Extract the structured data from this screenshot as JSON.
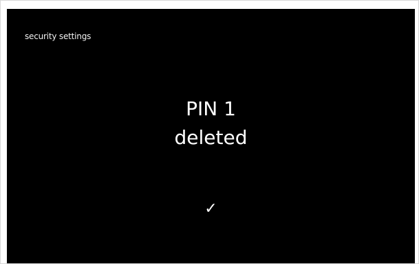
{
  "screen": {
    "title": "security settings",
    "message_line1": "PIN 1",
    "message_line2": "deleted",
    "confirm_symbol": "✓",
    "confirm_icon": "checkmark-icon",
    "background_color": "#000000",
    "text_color": "#ffffff"
  }
}
